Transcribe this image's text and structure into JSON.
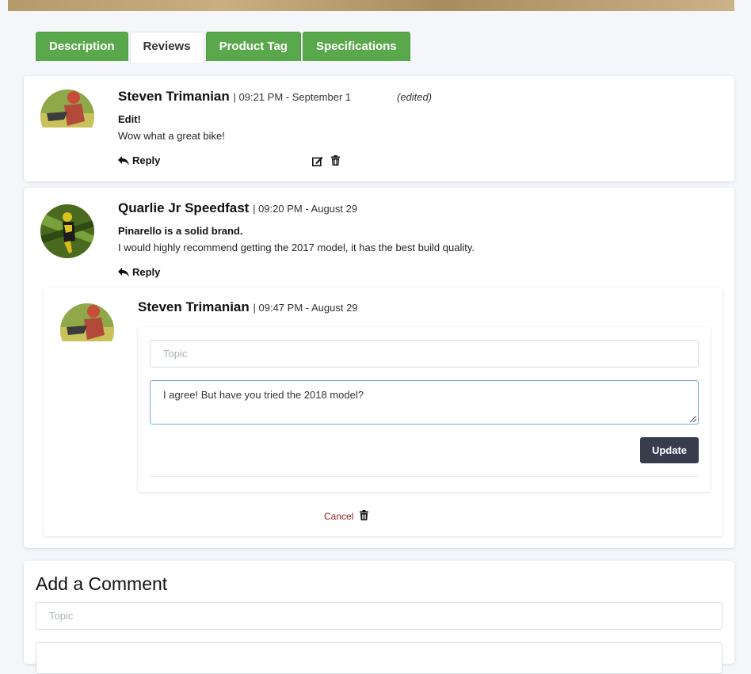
{
  "tabs": [
    {
      "label": "Description"
    },
    {
      "label": "Reviews"
    },
    {
      "label": "Product Tag"
    },
    {
      "label": "Specifications"
    }
  ],
  "reviews": [
    {
      "author": "Steven Trimanian",
      "meta": "| 09:21 PM - September 1",
      "edited": "(edited)",
      "topic": "Edit!",
      "body": "Wow what a great bike!",
      "reply_label": "Reply"
    },
    {
      "author": "Quarlie Jr Speedfast",
      "meta": "| 09:20 PM - August 29",
      "topic": "Pinarello is a solid brand.",
      "body": "I would highly recommend getting the 2017 model, it has the best build quality.",
      "reply_label": "Reply",
      "reply": {
        "author": "Steven Trimanian",
        "meta": "| 09:47 PM - August 29",
        "topic_placeholder": "Topic",
        "body_value": "I agree! But have you tried the 2018 model?",
        "update_label": "Update",
        "cancel_label": "Cancel"
      }
    }
  ],
  "add_comment": {
    "title": "Add a Comment",
    "topic_placeholder": "Topic"
  },
  "icons": {
    "edit": "edit-icon",
    "trash": "trash-icon",
    "reply": "reply-arrow-icon"
  },
  "colors": {
    "tab_green": "#5aa84c",
    "update_button": "#373d4d",
    "cancel_text": "#8b1d1d"
  }
}
